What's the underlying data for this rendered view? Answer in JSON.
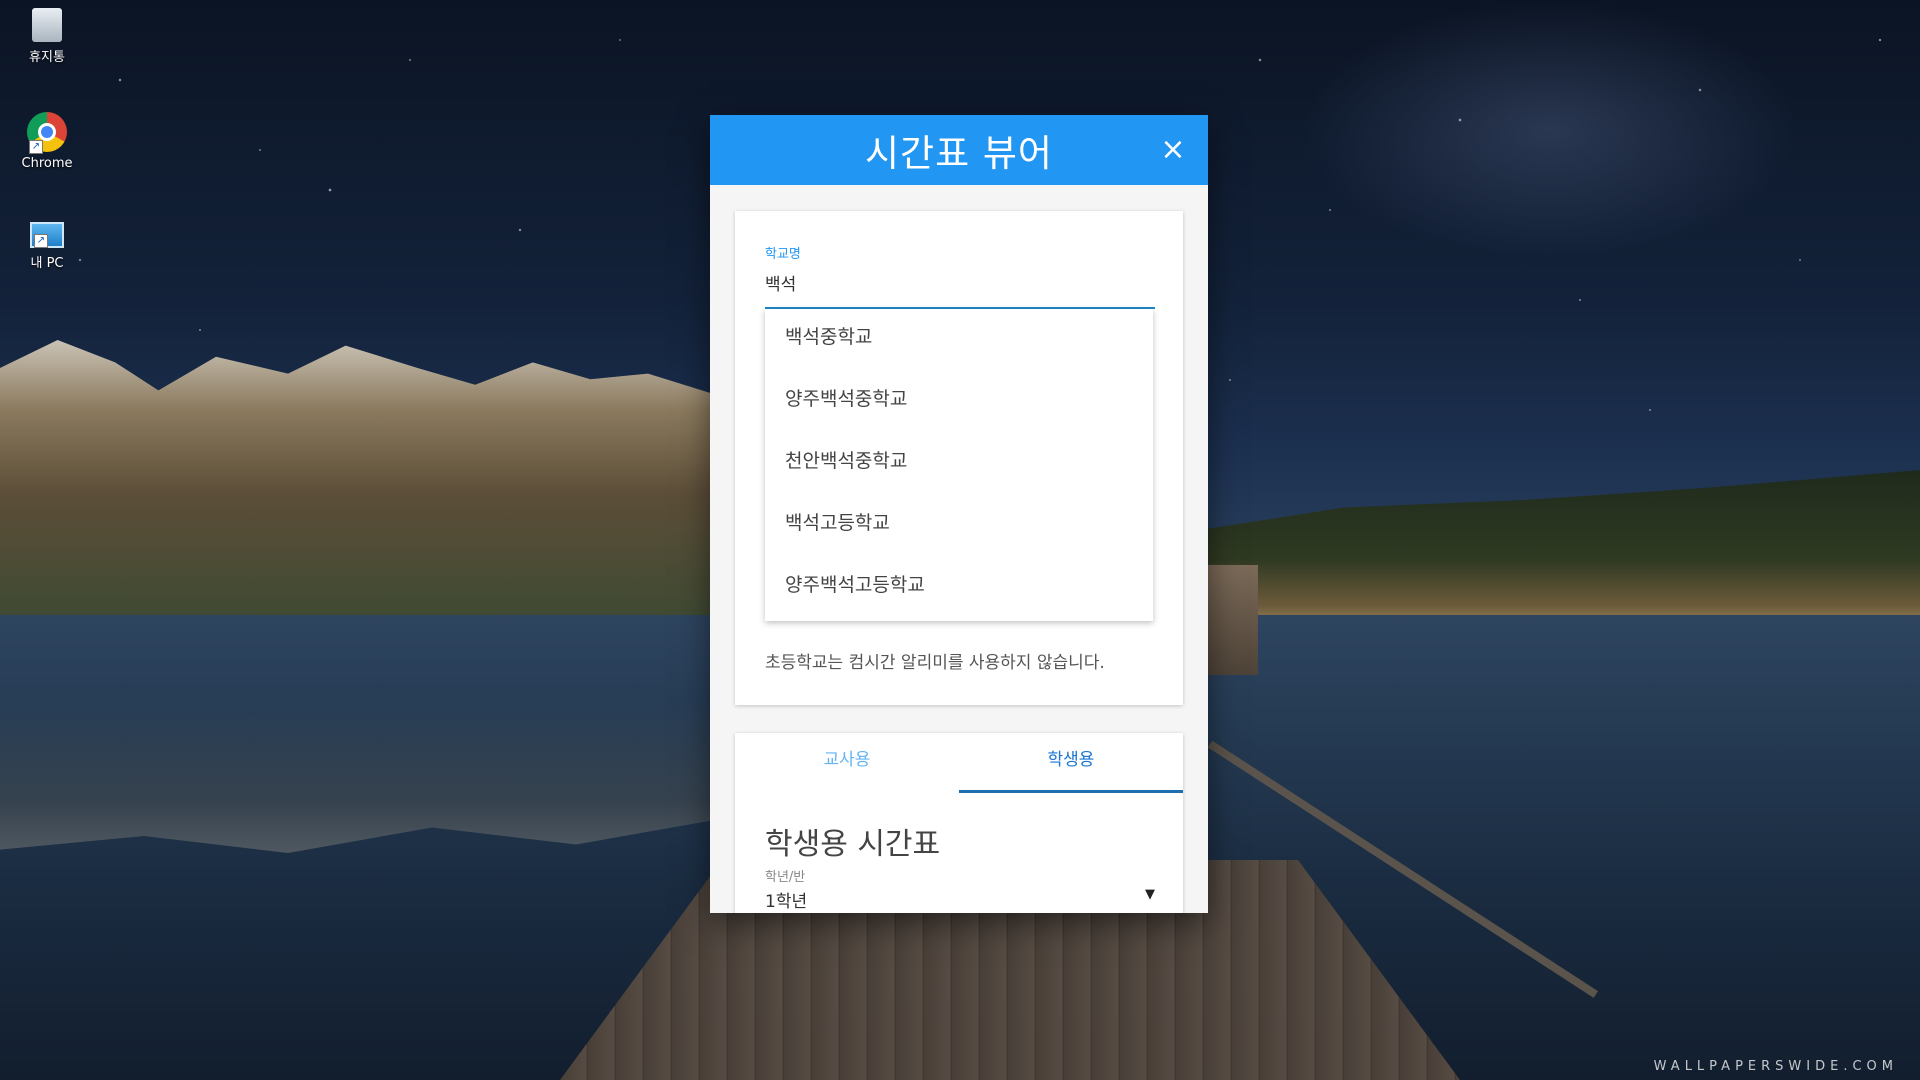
{
  "desktop": {
    "icons": [
      {
        "label": "휴지통",
        "icon": "recycle-bin-icon"
      },
      {
        "label": "Chrome",
        "icon": "chrome-icon"
      },
      {
        "label": "내 PC",
        "icon": "this-pc-icon"
      }
    ],
    "watermark": "WALLPAPERSWIDE.COM"
  },
  "dialog": {
    "title": "시간표 뷰어",
    "close_icon": "×",
    "accent_color": "#2196f3"
  },
  "school_search": {
    "label": "학교명",
    "value": "백석",
    "suggestions": [
      "백석중학교",
      "양주백석중학교",
      "천안백석중학교",
      "백석고등학교",
      "양주백석고등학교"
    ],
    "notice": "초등학교는 컴시간 알리미를 사용하지 않습니다."
  },
  "timetable": {
    "tabs": [
      {
        "label": "교사용",
        "active": false
      },
      {
        "label": "학생용",
        "active": true
      }
    ],
    "section_title": "학생용 시간표",
    "grade_label": "학년/반",
    "grade_value": "1학년",
    "dropdown_icon": "▼"
  }
}
